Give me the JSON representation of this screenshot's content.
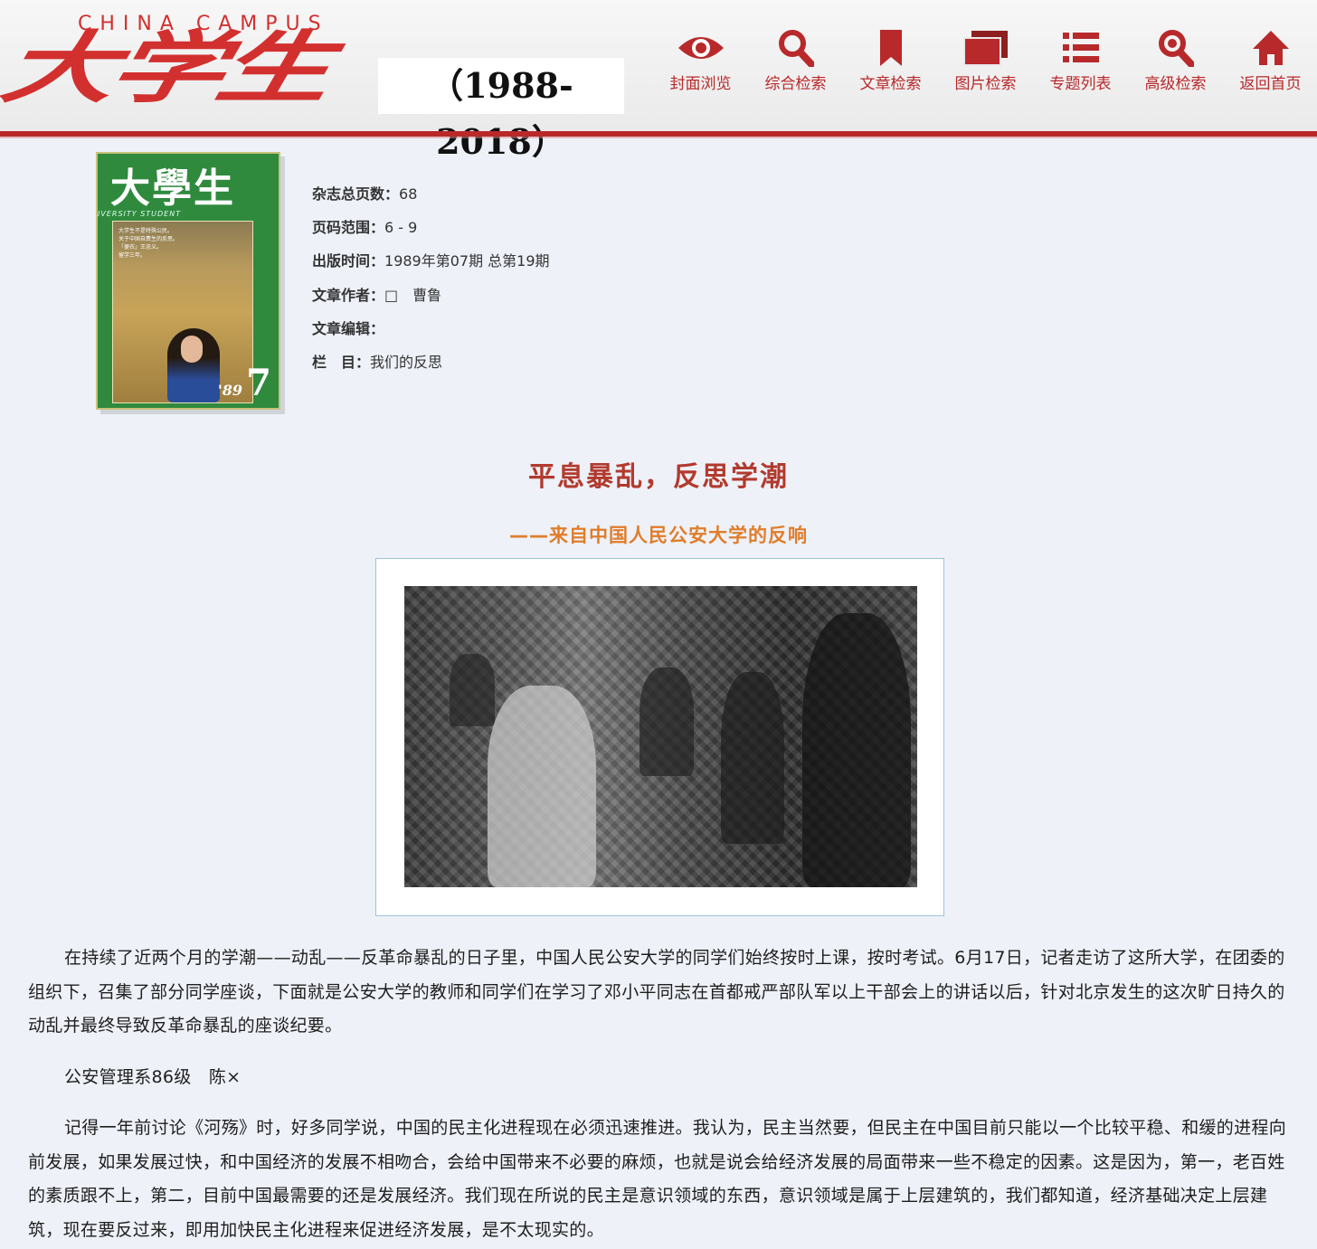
{
  "header": {
    "logo_latin": "CHINA CAMPUS",
    "logo_cn": "大学生",
    "years": "（1988-2018）",
    "nav": [
      {
        "label": "封面浏览",
        "icon": "eye-icon"
      },
      {
        "label": "综合检索",
        "icon": "search-icon"
      },
      {
        "label": "文章检索",
        "icon": "bookmark-icon"
      },
      {
        "label": "图片检索",
        "icon": "images-icon"
      },
      {
        "label": "专题列表",
        "icon": "list-icon"
      },
      {
        "label": "高级检索",
        "icon": "advanced-search-icon"
      },
      {
        "label": "返回首页",
        "icon": "home-icon"
      }
    ],
    "accent_color": "#b8292b"
  },
  "cover": {
    "title": "大學生",
    "subtitle": "IVERSITY STUDENT",
    "lines": [
      "大学生不是特殊公民。",
      "关于中国自费生的反思。",
      "「便衣」王忠义。",
      "留学三年。"
    ],
    "year": "'89",
    "issue": "7"
  },
  "meta": {
    "total_pages": {
      "key": "杂志总页数：",
      "value": "68"
    },
    "page_range": {
      "key": "页码范围：",
      "value": "6 - 9"
    },
    "published": {
      "key": "出版时间：",
      "value": "1989年第07期 总第19期"
    },
    "author": {
      "key": "文章作者：",
      "value": "□　曹鲁"
    },
    "editor": {
      "key": "文章编辑：",
      "value": ""
    },
    "column": {
      "key": "栏　目：",
      "value": "我们的反思"
    }
  },
  "article": {
    "title": "平息暴乱，反思学潮",
    "subtitle": "——来自中国人民公安大学的反响",
    "paragraphs": [
      "在持续了近两个月的学潮——动乱——反革命暴乱的日子里，中国人民公安大学的同学们始终按时上课，按时考试。6月17日，记者走访了这所大学，在团委的组织下，召集了部分同学座谈，下面就是公安大学的教师和同学们在学习了邓小平同志在首都戒严部队军以上干部会上的讲话以后，针对北京发生的这次旷日持久的动乱并最终导致反革命暴乱的座谈纪要。",
      "公安管理系86级　陈×",
      "记得一年前讨论《河殇》时，好多同学说，中国的民主化进程现在必须迅速推进。我认为，民主当然要，但民主在中国目前只能以一个比较平稳、和缓的进程向前发展，如果发展过快，和中国经济的发展不相吻合，会给中国带来不必要的麻烦，也就是说会给经济发展的局面带来一些不稳定的因素。这是因为，第一，老百姓的素质跟不上，第二，目前中国最需要的还是发展经济。我们现在所说的民主是意识领域的东西，意识领域是属于上层建筑的，我们都知道，经济基础决定上层建筑，现在要反过来，即用加快民主化进程来促进经济发展，是不太现实的。"
    ]
  }
}
